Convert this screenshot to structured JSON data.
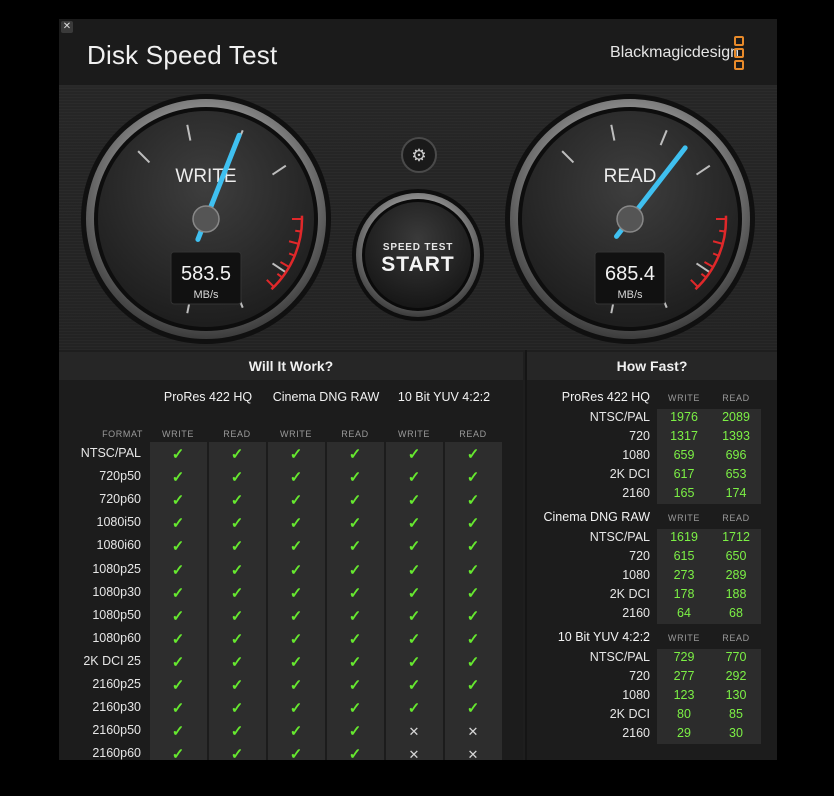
{
  "window": {
    "title": "Disk Speed Test",
    "brand": "Blackmagicdesign",
    "close_label": "✕",
    "accent": "#e88a2a"
  },
  "gauges": {
    "write": {
      "label": "WRITE",
      "value": "583.5",
      "unit": "MB/s",
      "level": 0.58
    },
    "read": {
      "label": "READ",
      "value": "685.4",
      "unit": "MB/s",
      "level": 0.64
    },
    "needle_color": "#3fc0f0",
    "redline_color": "#e0282a"
  },
  "start_button": {
    "top": "SPEED TEST",
    "main": "START"
  },
  "settings_icon": "gear-icon",
  "will_it_work": {
    "title": "Will It Work?",
    "format_label": "FORMAT",
    "codecs": [
      "ProRes 422 HQ",
      "Cinema DNG RAW",
      "10 Bit YUV 4:2:2"
    ],
    "write_label": "WRITE",
    "read_label": "READ",
    "rows": [
      {
        "format": "NTSC/PAL",
        "marks": [
          "✓",
          "✓",
          "✓",
          "✓",
          "✓",
          "✓"
        ]
      },
      {
        "format": "720p50",
        "marks": [
          "✓",
          "✓",
          "✓",
          "✓",
          "✓",
          "✓"
        ]
      },
      {
        "format": "720p60",
        "marks": [
          "✓",
          "✓",
          "✓",
          "✓",
          "✓",
          "✓"
        ]
      },
      {
        "format": "1080i50",
        "marks": [
          "✓",
          "✓",
          "✓",
          "✓",
          "✓",
          "✓"
        ]
      },
      {
        "format": "1080i60",
        "marks": [
          "✓",
          "✓",
          "✓",
          "✓",
          "✓",
          "✓"
        ]
      },
      {
        "format": "1080p25",
        "marks": [
          "✓",
          "✓",
          "✓",
          "✓",
          "✓",
          "✓"
        ]
      },
      {
        "format": "1080p30",
        "marks": [
          "✓",
          "✓",
          "✓",
          "✓",
          "✓",
          "✓"
        ]
      },
      {
        "format": "1080p50",
        "marks": [
          "✓",
          "✓",
          "✓",
          "✓",
          "✓",
          "✓"
        ]
      },
      {
        "format": "1080p60",
        "marks": [
          "✓",
          "✓",
          "✓",
          "✓",
          "✓",
          "✓"
        ]
      },
      {
        "format": "2K DCI 25",
        "marks": [
          "✓",
          "✓",
          "✓",
          "✓",
          "✓",
          "✓"
        ]
      },
      {
        "format": "2160p25",
        "marks": [
          "✓",
          "✓",
          "✓",
          "✓",
          "✓",
          "✓"
        ]
      },
      {
        "format": "2160p30",
        "marks": [
          "✓",
          "✓",
          "✓",
          "✓",
          "✓",
          "✓"
        ]
      },
      {
        "format": "2160p50",
        "marks": [
          "✓",
          "✓",
          "✓",
          "✓",
          "✕",
          "✕"
        ]
      },
      {
        "format": "2160p60",
        "marks": [
          "✓",
          "✓",
          "✓",
          "✓",
          "✕",
          "✕"
        ]
      }
    ]
  },
  "how_fast": {
    "title": "How Fast?",
    "write_label": "WRITE",
    "read_label": "READ",
    "groups": [
      {
        "codec": "ProRes 422 HQ",
        "rows": [
          {
            "format": "NTSC/PAL",
            "write": "1976",
            "read": "2089"
          },
          {
            "format": "720",
            "write": "1317",
            "read": "1393"
          },
          {
            "format": "1080",
            "write": "659",
            "read": "696"
          },
          {
            "format": "2K DCI",
            "write": "617",
            "read": "653"
          },
          {
            "format": "2160",
            "write": "165",
            "read": "174"
          }
        ]
      },
      {
        "codec": "Cinema DNG RAW",
        "rows": [
          {
            "format": "NTSC/PAL",
            "write": "1619",
            "read": "1712"
          },
          {
            "format": "720",
            "write": "615",
            "read": "650"
          },
          {
            "format": "1080",
            "write": "273",
            "read": "289"
          },
          {
            "format": "2K DCI",
            "write": "178",
            "read": "188"
          },
          {
            "format": "2160",
            "write": "64",
            "read": "68"
          }
        ]
      },
      {
        "codec": "10 Bit YUV 4:2:2",
        "rows": [
          {
            "format": "NTSC/PAL",
            "write": "729",
            "read": "770"
          },
          {
            "format": "720",
            "write": "277",
            "read": "292"
          },
          {
            "format": "1080",
            "write": "123",
            "read": "130"
          },
          {
            "format": "2K DCI",
            "write": "80",
            "read": "85"
          },
          {
            "format": "2160",
            "write": "29",
            "read": "30"
          }
        ]
      }
    ]
  }
}
